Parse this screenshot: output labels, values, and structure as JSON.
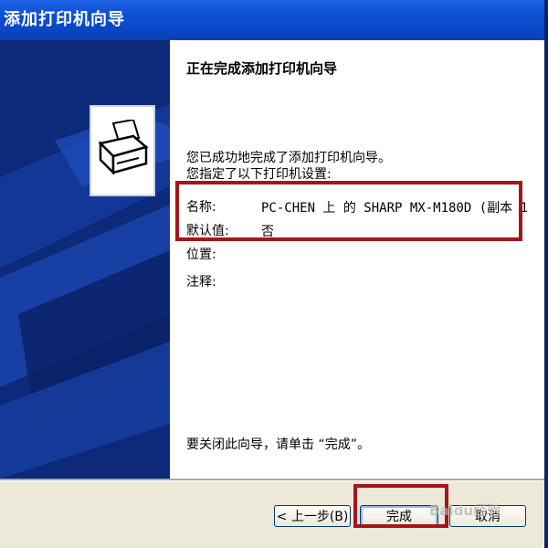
{
  "window": {
    "title": "添加打印机向导"
  },
  "content": {
    "heading": "正在完成添加打印机向导",
    "intro_line1": "您已成功地完成了添加打印机向导。",
    "intro_line2": "您指定了以下打印机设置:",
    "fields": [
      {
        "label": "名称:",
        "value": "PC-CHEN 上 的 SHARP MX-M180D (副本 1"
      },
      {
        "label": "默认值:",
        "value": "否"
      },
      {
        "label": "位置:",
        "value": ""
      },
      {
        "label": "注释:",
        "value": ""
      }
    ],
    "closing": "要关闭此向导，请单击 “完成”。"
  },
  "buttons": {
    "back": "< 上一步(B)",
    "finish": "完成",
    "cancel": "取消"
  },
  "colors": {
    "title_bar": "#0a47c7",
    "left_panel": "#0d2a7a",
    "highlight": "#a4161a",
    "button_bar": "#ece9d8"
  },
  "watermark": "Baidu经验"
}
